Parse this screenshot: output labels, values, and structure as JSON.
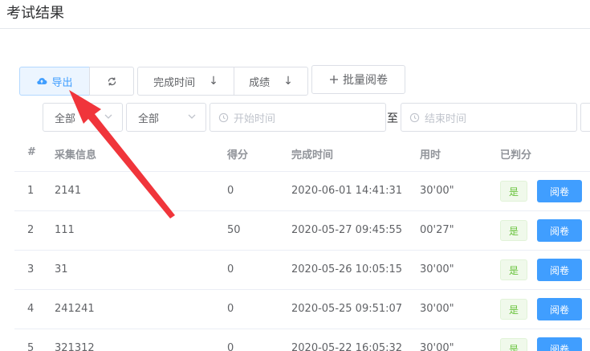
{
  "page": {
    "title": "考试结果"
  },
  "toolbar": {
    "export_label": "导出",
    "sort_time_label": "完成时间",
    "sort_score_label": "成绩",
    "sort_arrow": "↓",
    "batch_label": "批量阅卷"
  },
  "filters": {
    "select_1": "全部",
    "select_2": "全部",
    "start_placeholder": "开始时间",
    "range_separator": "至",
    "end_placeholder": "结束时间"
  },
  "table": {
    "headers": [
      "#",
      "采集信息",
      "得分",
      "完成时间",
      "用时",
      "已判分"
    ],
    "rows": [
      {
        "index": "1",
        "info": "2141",
        "score": "0",
        "time": "2020-06-01 14:41:31",
        "duration": "30'00\"",
        "judged": "是",
        "action": "阅卷"
      },
      {
        "index": "2",
        "info": "111",
        "score": "50",
        "time": "2020-05-27 09:45:55",
        "duration": "00'27\"",
        "judged": "是",
        "action": "阅卷"
      },
      {
        "index": "3",
        "info": "31",
        "score": "0",
        "time": "2020-05-26 10:05:15",
        "duration": "30'00\"",
        "judged": "是",
        "action": "阅卷"
      },
      {
        "index": "4",
        "info": "241241",
        "score": "0",
        "time": "2020-05-25 09:51:07",
        "duration": "30'00\"",
        "judged": "是",
        "action": "阅卷"
      },
      {
        "index": "5",
        "info": "321312",
        "score": "0",
        "time": "2020-05-22 16:05:32",
        "duration": "30'00\"",
        "judged": "是",
        "action": "阅卷"
      }
    ]
  },
  "colors": {
    "primary": "#409eff",
    "success": "#67c23a",
    "annotation": "#f0353b"
  }
}
